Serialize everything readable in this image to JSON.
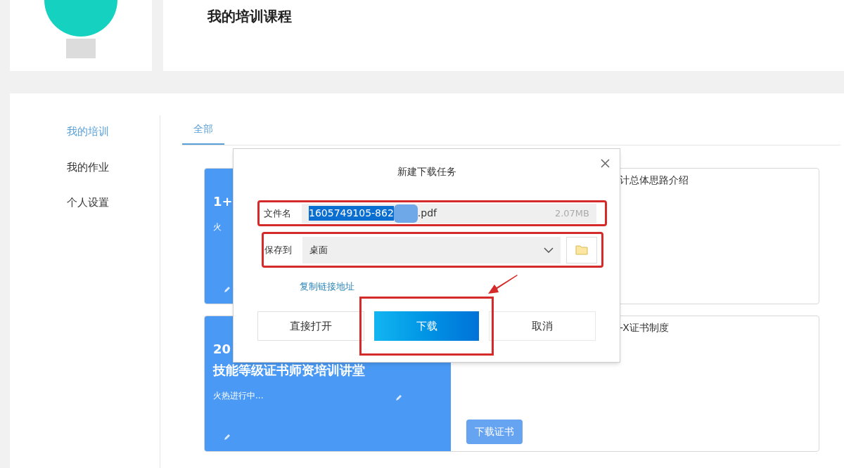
{
  "header": {
    "title": "我的培训课程"
  },
  "sidebar": {
    "items": [
      {
        "label": "我的培训",
        "selected": true
      },
      {
        "label": "我的作业",
        "selected": false
      },
      {
        "label": "个人设置",
        "selected": false
      }
    ]
  },
  "tabs": [
    {
      "label": "全部",
      "selected": true
    }
  ],
  "courses": [
    {
      "banner_lines": [
        "1+"
      ],
      "banner_subtitle": "火",
      "title": "计总体思路介绍"
    },
    {
      "banner_lines": [
        "20",
        "技能等级证书师资培训讲堂"
      ],
      "banner_subtitle": "火热进行中...",
      "title": "-X证书制度",
      "button": "下载证书"
    }
  ],
  "dialog": {
    "title": "新建下载任务",
    "filename_label": "文件名",
    "filename_selected": "1605749105-862",
    "filename_rest": ".pdf",
    "file_size": "2.07MB",
    "save_label": "保存到",
    "save_location": "桌面",
    "copy_link": "复制链接地址",
    "buttons": [
      {
        "label": "直接打开",
        "kind": "secondary",
        "highlighted": false
      },
      {
        "label": "下载",
        "kind": "primary",
        "highlighted": true
      },
      {
        "label": "取消",
        "kind": "plain",
        "highlighted": false
      }
    ]
  }
}
